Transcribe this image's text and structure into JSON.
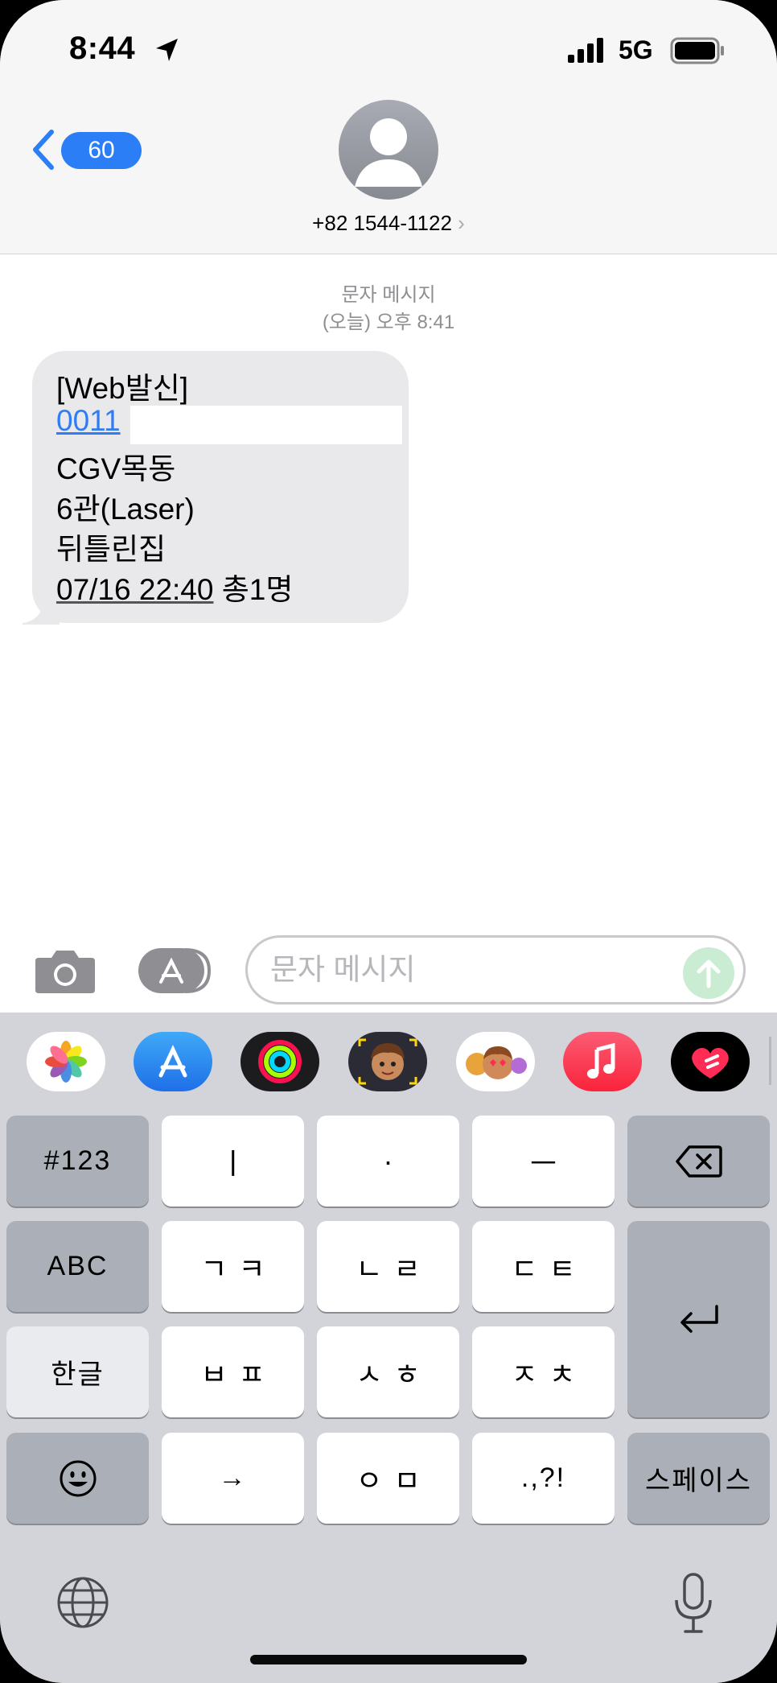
{
  "status_bar": {
    "time": "8:44",
    "network": "5G"
  },
  "header": {
    "back_badge": "60",
    "contact": "+82 1544-1122",
    "chevron": "›"
  },
  "conversation": {
    "service_label": "문자 메시지",
    "timestamp": "(오늘) 오후 8:41",
    "message": {
      "line1": "[Web발신]",
      "line2": "0011",
      "line3": "CGV목동",
      "line4": "6관(Laser)",
      "line5": "뒤틀린집",
      "line6_date": "07/16 22:40",
      "line6_rest": " 총1명"
    }
  },
  "input": {
    "placeholder": "문자 메시지"
  },
  "app_tray": [
    "photos-app-icon",
    "app-store-icon",
    "activity-app-icon",
    "memoji-app-icon",
    "animoji-app-icon",
    "music-app-icon",
    "digital-touch-app-icon"
  ],
  "keyboard": {
    "row1": [
      "#123",
      "ㅣ",
      "·",
      "ㅡ"
    ],
    "row2": [
      "ABC",
      "ㄱㅋ",
      "ㄴㄹ",
      "ㄷㅌ"
    ],
    "row3": [
      "한글",
      "ㅂㅍ",
      "ㅅㅎ",
      "ㅈㅊ"
    ],
    "row4": [
      "→",
      "ㅇㅁ",
      ".,?!",
      "스페이스"
    ]
  }
}
